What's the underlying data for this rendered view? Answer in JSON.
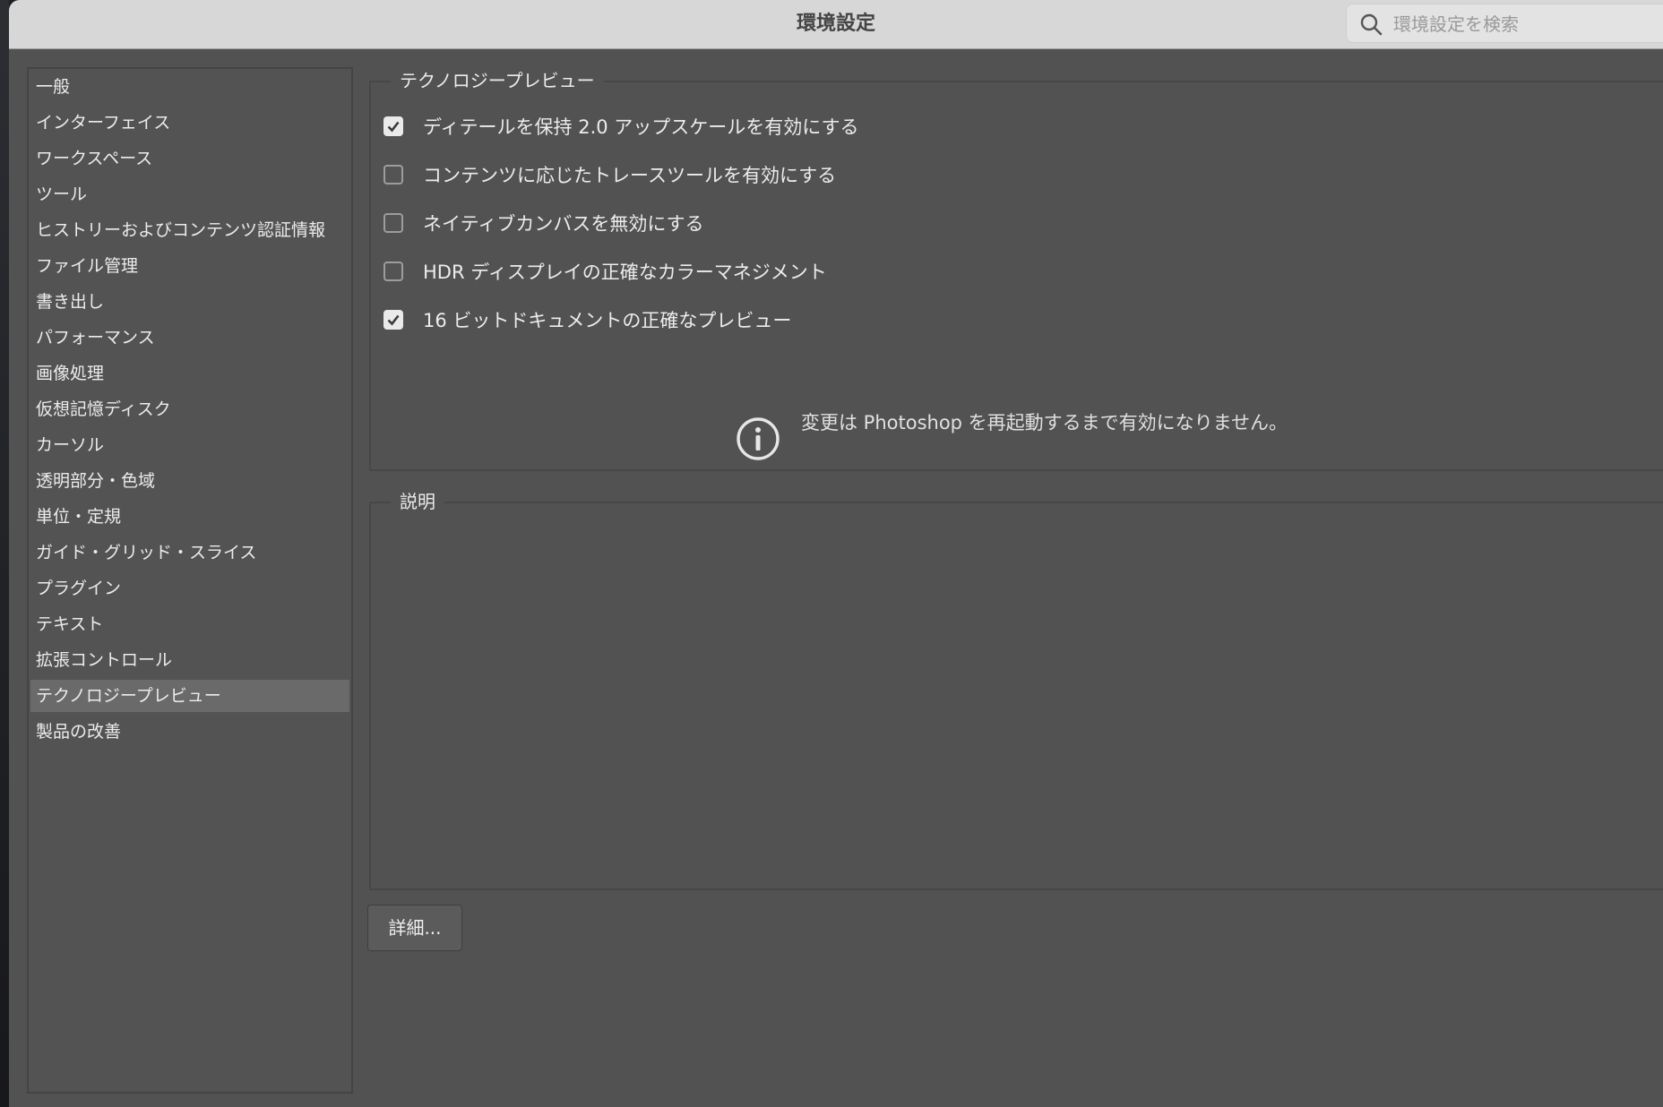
{
  "window": {
    "title": "環境設定"
  },
  "search": {
    "placeholder": "環境設定を検索"
  },
  "sidebar": {
    "items": [
      {
        "label": "一般"
      },
      {
        "label": "インターフェイス"
      },
      {
        "label": "ワークスペース"
      },
      {
        "label": "ツール"
      },
      {
        "label": "ヒストリーおよびコンテンツ認証情報"
      },
      {
        "label": "ファイル管理"
      },
      {
        "label": "書き出し"
      },
      {
        "label": "パフォーマンス"
      },
      {
        "label": "画像処理"
      },
      {
        "label": "仮想記憶ディスク"
      },
      {
        "label": "カーソル"
      },
      {
        "label": "透明部分・色域"
      },
      {
        "label": "単位・定規"
      },
      {
        "label": "ガイド・グリッド・スライス"
      },
      {
        "label": "プラグイン"
      },
      {
        "label": "テキスト"
      },
      {
        "label": "拡張コントロール"
      },
      {
        "label": "テクノロジープレビュー"
      },
      {
        "label": "製品の改善"
      }
    ],
    "selected": "テクノロジープレビュー"
  },
  "tech_preview": {
    "group_title": "テクノロジープレビュー",
    "options": [
      {
        "label": "ディテールを保持 2.0 アップスケールを有効にする",
        "checked": true
      },
      {
        "label": "コンテンツに応じたトレースツールを有効にする",
        "checked": false
      },
      {
        "label": "ネイティブカンバスを無効にする",
        "checked": false
      },
      {
        "label": "HDR ディスプレイの正確なカラーマネジメント",
        "checked": false
      },
      {
        "label": "16 ビットドキュメントの正確なプレビュー",
        "checked": true
      }
    ],
    "info_icon": "info-circle-icon",
    "info_message": "変更は Photoshop を再起動するまで有効になりません。"
  },
  "description": {
    "group_title": "説明"
  },
  "details_button": {
    "label": "詳細..."
  }
}
